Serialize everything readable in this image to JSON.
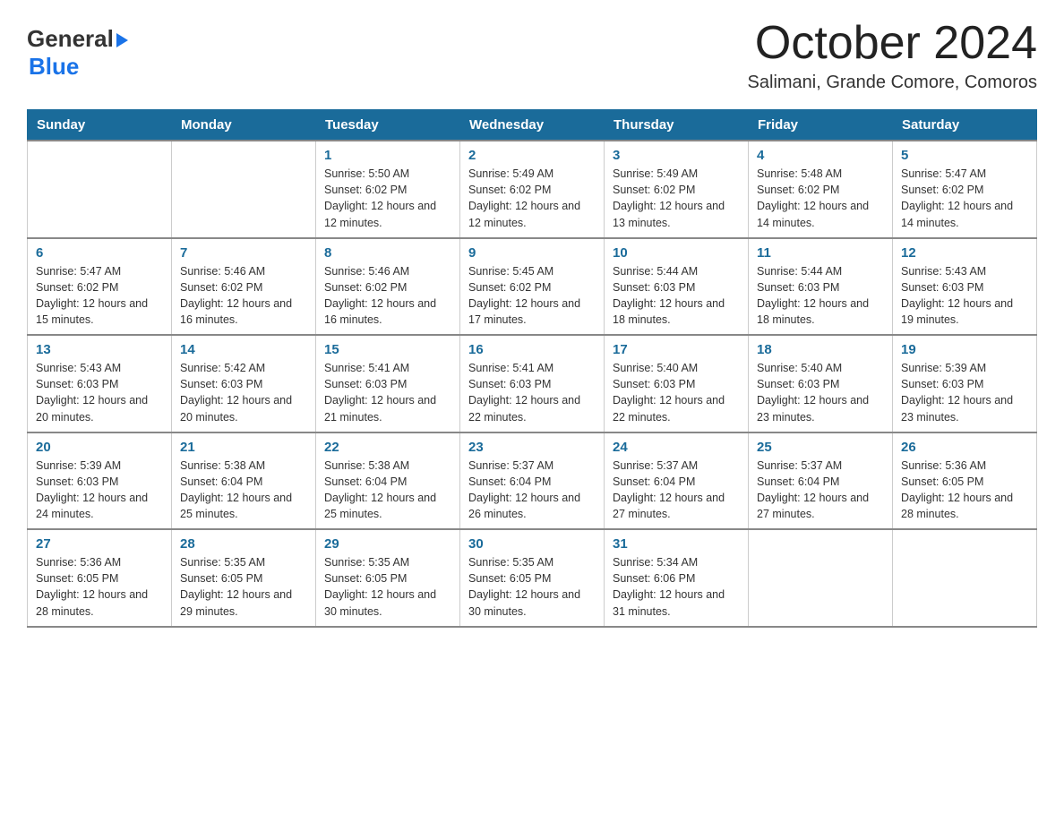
{
  "header": {
    "logo": {
      "general": "General",
      "arrow": "▶",
      "blue": "Blue"
    },
    "title": "October 2024",
    "location": "Salimani, Grande Comore, Comoros"
  },
  "days_of_week": [
    "Sunday",
    "Monday",
    "Tuesday",
    "Wednesday",
    "Thursday",
    "Friday",
    "Saturday"
  ],
  "weeks": [
    [
      {
        "day": "",
        "info": ""
      },
      {
        "day": "",
        "info": ""
      },
      {
        "day": "1",
        "info": "Sunrise: 5:50 AM\nSunset: 6:02 PM\nDaylight: 12 hours and 12 minutes."
      },
      {
        "day": "2",
        "info": "Sunrise: 5:49 AM\nSunset: 6:02 PM\nDaylight: 12 hours and 12 minutes."
      },
      {
        "day": "3",
        "info": "Sunrise: 5:49 AM\nSunset: 6:02 PM\nDaylight: 12 hours and 13 minutes."
      },
      {
        "day": "4",
        "info": "Sunrise: 5:48 AM\nSunset: 6:02 PM\nDaylight: 12 hours and 14 minutes."
      },
      {
        "day": "5",
        "info": "Sunrise: 5:47 AM\nSunset: 6:02 PM\nDaylight: 12 hours and 14 minutes."
      }
    ],
    [
      {
        "day": "6",
        "info": "Sunrise: 5:47 AM\nSunset: 6:02 PM\nDaylight: 12 hours and 15 minutes."
      },
      {
        "day": "7",
        "info": "Sunrise: 5:46 AM\nSunset: 6:02 PM\nDaylight: 12 hours and 16 minutes."
      },
      {
        "day": "8",
        "info": "Sunrise: 5:46 AM\nSunset: 6:02 PM\nDaylight: 12 hours and 16 minutes."
      },
      {
        "day": "9",
        "info": "Sunrise: 5:45 AM\nSunset: 6:02 PM\nDaylight: 12 hours and 17 minutes."
      },
      {
        "day": "10",
        "info": "Sunrise: 5:44 AM\nSunset: 6:03 PM\nDaylight: 12 hours and 18 minutes."
      },
      {
        "day": "11",
        "info": "Sunrise: 5:44 AM\nSunset: 6:03 PM\nDaylight: 12 hours and 18 minutes."
      },
      {
        "day": "12",
        "info": "Sunrise: 5:43 AM\nSunset: 6:03 PM\nDaylight: 12 hours and 19 minutes."
      }
    ],
    [
      {
        "day": "13",
        "info": "Sunrise: 5:43 AM\nSunset: 6:03 PM\nDaylight: 12 hours and 20 minutes."
      },
      {
        "day": "14",
        "info": "Sunrise: 5:42 AM\nSunset: 6:03 PM\nDaylight: 12 hours and 20 minutes."
      },
      {
        "day": "15",
        "info": "Sunrise: 5:41 AM\nSunset: 6:03 PM\nDaylight: 12 hours and 21 minutes."
      },
      {
        "day": "16",
        "info": "Sunrise: 5:41 AM\nSunset: 6:03 PM\nDaylight: 12 hours and 22 minutes."
      },
      {
        "day": "17",
        "info": "Sunrise: 5:40 AM\nSunset: 6:03 PM\nDaylight: 12 hours and 22 minutes."
      },
      {
        "day": "18",
        "info": "Sunrise: 5:40 AM\nSunset: 6:03 PM\nDaylight: 12 hours and 23 minutes."
      },
      {
        "day": "19",
        "info": "Sunrise: 5:39 AM\nSunset: 6:03 PM\nDaylight: 12 hours and 23 minutes."
      }
    ],
    [
      {
        "day": "20",
        "info": "Sunrise: 5:39 AM\nSunset: 6:03 PM\nDaylight: 12 hours and 24 minutes."
      },
      {
        "day": "21",
        "info": "Sunrise: 5:38 AM\nSunset: 6:04 PM\nDaylight: 12 hours and 25 minutes."
      },
      {
        "day": "22",
        "info": "Sunrise: 5:38 AM\nSunset: 6:04 PM\nDaylight: 12 hours and 25 minutes."
      },
      {
        "day": "23",
        "info": "Sunrise: 5:37 AM\nSunset: 6:04 PM\nDaylight: 12 hours and 26 minutes."
      },
      {
        "day": "24",
        "info": "Sunrise: 5:37 AM\nSunset: 6:04 PM\nDaylight: 12 hours and 27 minutes."
      },
      {
        "day": "25",
        "info": "Sunrise: 5:37 AM\nSunset: 6:04 PM\nDaylight: 12 hours and 27 minutes."
      },
      {
        "day": "26",
        "info": "Sunrise: 5:36 AM\nSunset: 6:05 PM\nDaylight: 12 hours and 28 minutes."
      }
    ],
    [
      {
        "day": "27",
        "info": "Sunrise: 5:36 AM\nSunset: 6:05 PM\nDaylight: 12 hours and 28 minutes."
      },
      {
        "day": "28",
        "info": "Sunrise: 5:35 AM\nSunset: 6:05 PM\nDaylight: 12 hours and 29 minutes."
      },
      {
        "day": "29",
        "info": "Sunrise: 5:35 AM\nSunset: 6:05 PM\nDaylight: 12 hours and 30 minutes."
      },
      {
        "day": "30",
        "info": "Sunrise: 5:35 AM\nSunset: 6:05 PM\nDaylight: 12 hours and 30 minutes."
      },
      {
        "day": "31",
        "info": "Sunrise: 5:34 AM\nSunset: 6:06 PM\nDaylight: 12 hours and 31 minutes."
      },
      {
        "day": "",
        "info": ""
      },
      {
        "day": "",
        "info": ""
      }
    ]
  ]
}
